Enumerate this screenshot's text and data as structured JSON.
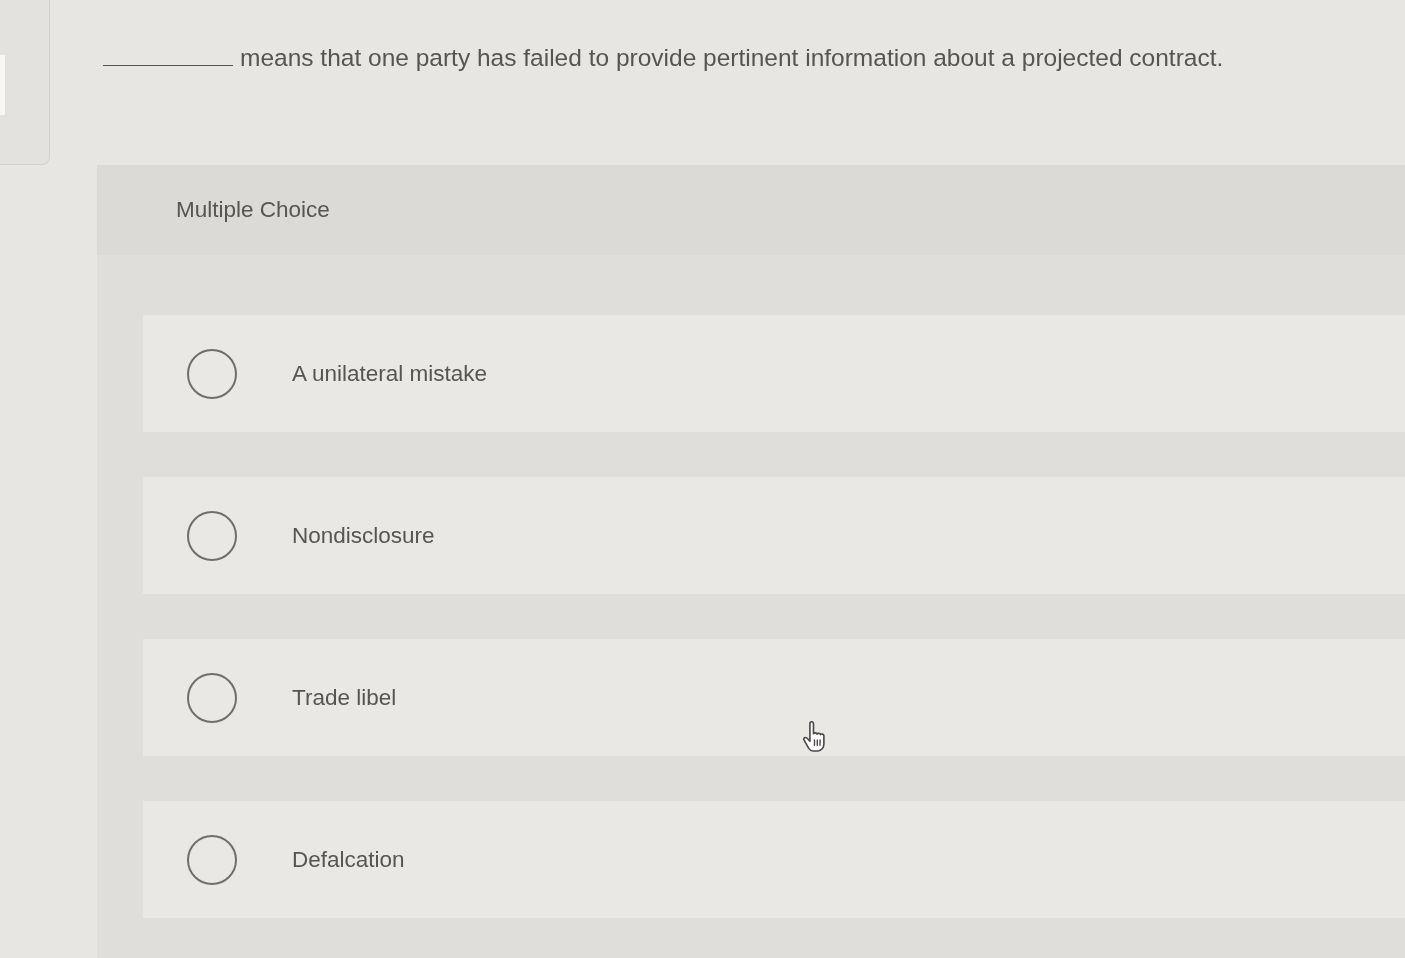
{
  "question": {
    "text": "means that one party has failed to provide pertinent information about a projected contract."
  },
  "section_label": "Multiple Choice",
  "choices": [
    {
      "label": "A unilateral mistake",
      "selected": false
    },
    {
      "label": "Nondisclosure",
      "selected": false
    },
    {
      "label": "Trade libel",
      "selected": false
    },
    {
      "label": "Defalcation",
      "selected": false
    }
  ]
}
